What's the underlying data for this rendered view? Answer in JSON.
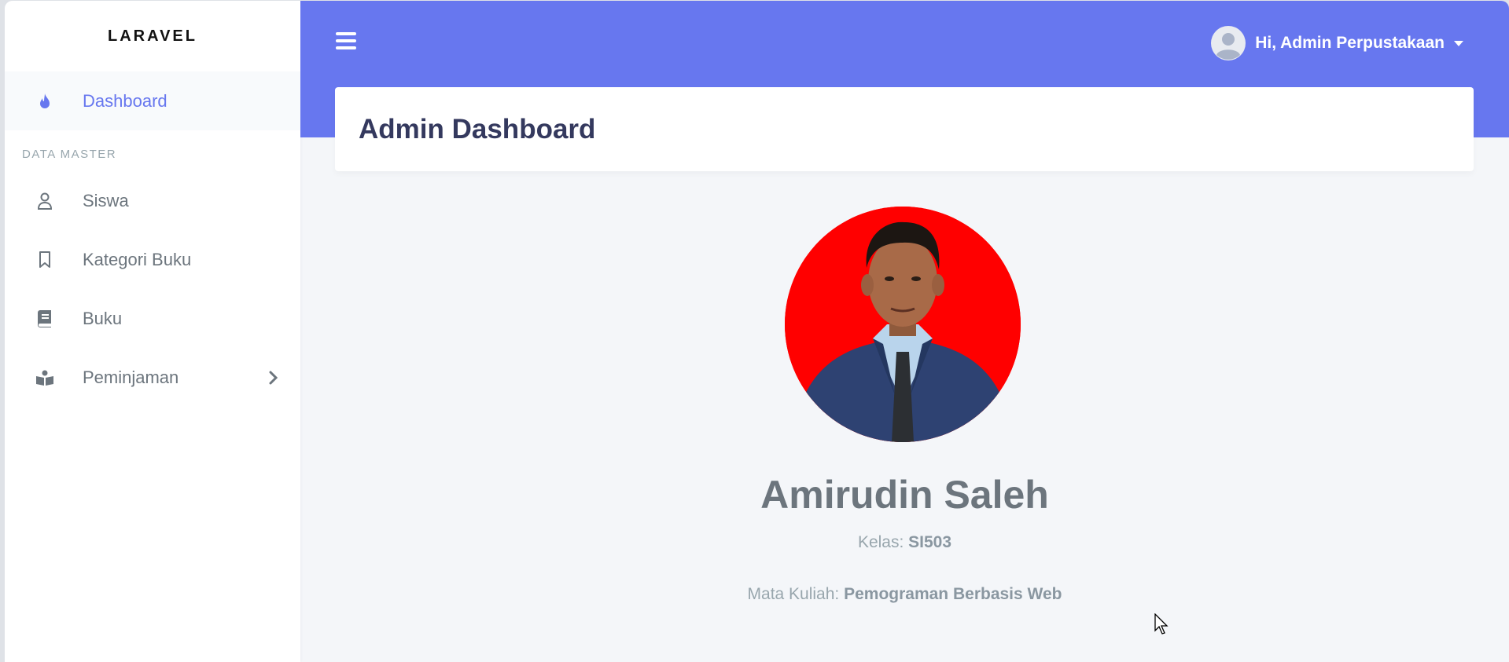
{
  "brand": "LARAVEL",
  "sidebar": {
    "items": [
      {
        "label": "Dashboard",
        "icon": "fire-icon",
        "active": true
      },
      {
        "label": "Siswa",
        "icon": "user-icon"
      },
      {
        "label": "Kategori Buku",
        "icon": "bookmark-icon"
      },
      {
        "label": "Buku",
        "icon": "book-icon"
      },
      {
        "label": "Peminjaman",
        "icon": "reader-icon",
        "has_submenu": true
      }
    ],
    "header": "DATA MASTER"
  },
  "topbar": {
    "greeting": "Hi, Admin Perpustakaan"
  },
  "page": {
    "title": "Admin Dashboard"
  },
  "profile": {
    "name": "Amirudin Saleh",
    "class_label": "Kelas: ",
    "class_value": "SI503",
    "course_label": "Mata Kuliah: ",
    "course_value": "Pemograman Berbasis Web"
  },
  "colors": {
    "primary": "#6777ef",
    "photo_background": "#ff0000",
    "body_bg": "#f4f6f9"
  }
}
